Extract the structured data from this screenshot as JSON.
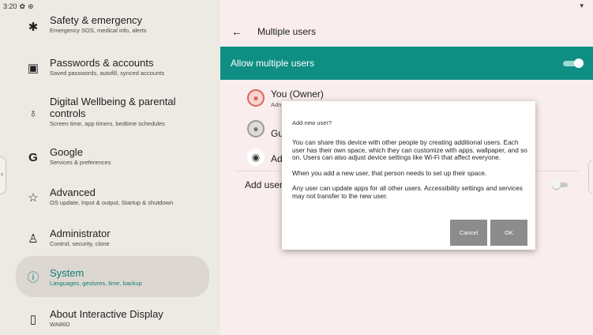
{
  "status_bar": {
    "time": "3:20",
    "icons": [
      "gear-icon",
      "circle-settings-icon"
    ],
    "wifi": "wifi-icon"
  },
  "sidebar": {
    "items": [
      {
        "title": "Safety & emergency",
        "subtitle": "Emergency SOS, medical info, alerts",
        "icon": "✱"
      },
      {
        "title": "Passwords & accounts",
        "subtitle": "Saved passwords, autofill, synced accounts",
        "icon": "▣"
      },
      {
        "title": "Digital Wellbeing & parental controls",
        "subtitle": "Screen time, app timers, bedtime schedules",
        "icon": "♁"
      },
      {
        "title": "Google",
        "subtitle": "Services & preferences",
        "icon": "G"
      },
      {
        "title": "Advanced",
        "subtitle": "OS update, Input & output, Startup & shutdown",
        "icon": "☆"
      },
      {
        "title": "Administrator",
        "subtitle": "Control, security, clone",
        "icon": "♙"
      },
      {
        "title": "System",
        "subtitle": "Languages, gestures, time, backup",
        "icon": "ⓘ"
      },
      {
        "title": "About Interactive Display",
        "subtitle": "WA86D",
        "icon": "▯"
      }
    ],
    "handle": "›"
  },
  "header": {
    "back": "←",
    "title": "Multiple users"
  },
  "allow_banner": {
    "label": "Allow multiple users",
    "enabled": true
  },
  "users": {
    "owner": {
      "title": "You (Owner)",
      "subtitle": "Adn"
    },
    "guest": {
      "title": "Gu"
    },
    "add": {
      "title": "Ad"
    },
    "add_lock": {
      "label": "Add user"
    }
  },
  "dialog": {
    "title": "Add new user?",
    "paragraphs": [
      "You can share this device with other people by creating additional users. Each user has their own space, which they can customize with apps, wallpaper, and so on. Users can also adjust device settings like Wi-Fi that affect everyone.",
      "When you add a new user, that person needs to set up their space.",
      "Any user can update apps for all other users. Accessibility settings and services may not transfer to the new user."
    ],
    "cancel_label": "Cancel",
    "ok_label": "OK"
  },
  "colors": {
    "accent": "#0f8e84",
    "selected_bg": "#dcd7d0",
    "button": "#8c8c8c"
  }
}
